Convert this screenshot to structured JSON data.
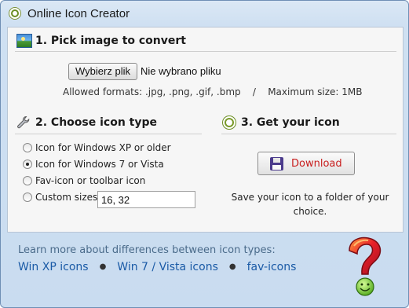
{
  "window": {
    "title": "Online Icon Creator"
  },
  "section1": {
    "title": "1. Pick image to convert",
    "file_button_label": "Wybierz plik",
    "file_status": "Nie wybrano pliku",
    "formats_note": "Allowed formats: .jpg, .png, .gif, .bmp    /    Maximum size: 1MB"
  },
  "section2": {
    "title": "2. Choose icon type",
    "options": [
      {
        "label": "Icon for Windows XP or older",
        "checked": false
      },
      {
        "label": "Icon for Windows 7 or Vista",
        "checked": true
      },
      {
        "label": "Fav-icon or toolbar icon",
        "checked": false
      },
      {
        "label": "Custom sizes",
        "checked": false
      }
    ],
    "custom_sizes_value": "16, 32"
  },
  "section3": {
    "title": "3. Get your icon",
    "download_label": "Download",
    "save_note": "Save your icon to a folder of your choice."
  },
  "footer": {
    "learn_more": "Learn more about differences between icon types:",
    "links": [
      {
        "label": "Win XP icons"
      },
      {
        "label": "Win 7 / Vista icons"
      },
      {
        "label": "fav-icons"
      }
    ]
  },
  "colors": {
    "link": "#1a5aa6",
    "download_text": "#c81e1e",
    "footer_text": "#4a6b8a"
  },
  "icons": {
    "title": "app-ring-icon",
    "section1": "picture-icon",
    "section2": "wrench-icon",
    "section3": "ring-icon",
    "download": "floppy-disk-icon",
    "help": "question-mark-smiley-icon"
  }
}
